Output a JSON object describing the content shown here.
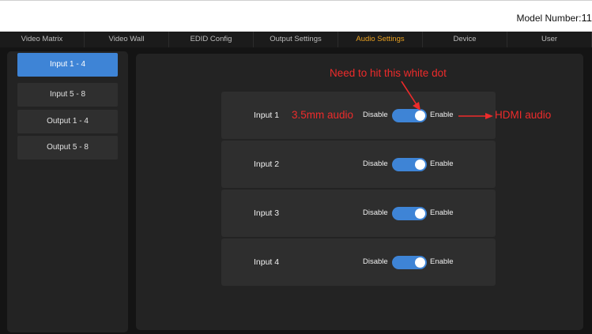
{
  "header": {
    "model_label": "Model Number:",
    "model_value": "11"
  },
  "nav": {
    "items": [
      {
        "label": "Video Matrix",
        "active": false
      },
      {
        "label": "Video Wall",
        "active": false
      },
      {
        "label": "EDID Config",
        "active": false
      },
      {
        "label": "Output Settings",
        "active": false
      },
      {
        "label": "Audio Settings",
        "active": true
      },
      {
        "label": "Device",
        "active": false
      },
      {
        "label": "User",
        "active": false
      }
    ]
  },
  "sidebar": {
    "items": [
      {
        "label": "Input 1 - 4",
        "active": true
      },
      {
        "label": "Input 5 - 8",
        "active": false
      },
      {
        "label": "Output 1 - 4",
        "active": false
      },
      {
        "label": "Output 5 - 8",
        "active": false
      }
    ]
  },
  "audio_rows": [
    {
      "label": "Input 1",
      "disable_label": "Disable",
      "enable_label": "Enable",
      "toggle": "Enable"
    },
    {
      "label": "Input 2",
      "disable_label": "Disable",
      "enable_label": "Enable",
      "toggle": "Enable"
    },
    {
      "label": "Input 3",
      "disable_label": "Disable",
      "enable_label": "Enable",
      "toggle": "Enable"
    },
    {
      "label": "Input 4",
      "disable_label": "Disable",
      "enable_label": "Enable",
      "toggle": "Enable"
    }
  ],
  "annotations": {
    "white_dot": "Need to hit this white dot",
    "left_mode": "3.5mm audio",
    "right_mode": "HDMI audio"
  },
  "colors": {
    "accent": "#3e84d6",
    "active_nav": "#e8a020",
    "annotation": "#ee2b2b"
  }
}
